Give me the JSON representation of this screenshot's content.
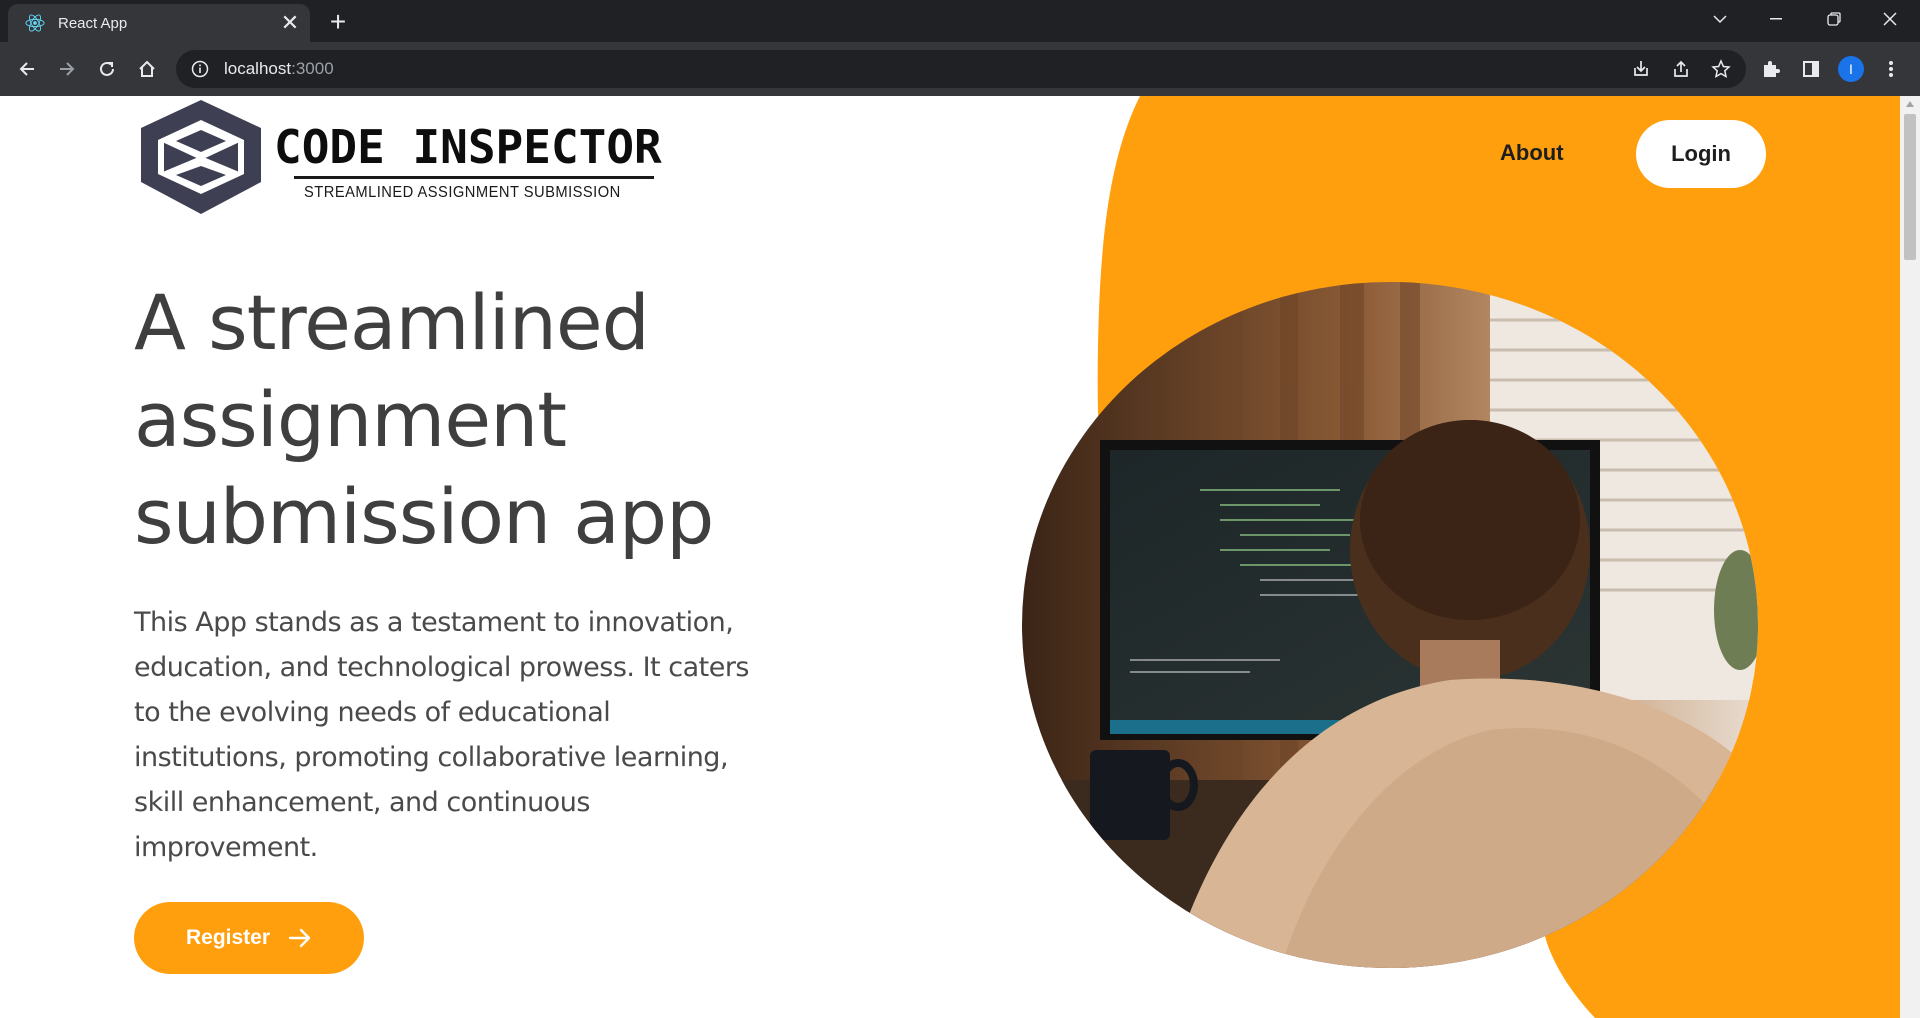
{
  "browser": {
    "tab_title": "React App",
    "url_host": "localhost",
    "url_port": ":3000",
    "profile_initial": "I"
  },
  "page": {
    "logo": {
      "title": "CODE INSPECTOR",
      "subtitle": "STREAMLINED ASSIGNMENT SUBMISSION"
    },
    "nav": {
      "about_label": "About",
      "login_label": "Login"
    },
    "hero": {
      "title": "A streamlined assignment submission app",
      "description": "This App stands as a testament to innovation, education, and technological prowess. It caters to the evolving needs of educational institutions, promoting collaborative learning, skill enhancement, and continuous improvement.",
      "register_label": "Register",
      "image_alt": "photo"
    }
  },
  "colors": {
    "accent": "#ff9f0d",
    "heading": "#3f3f3f",
    "logo_dark": "#3e3f52"
  },
  "icons": [
    "react-icon",
    "close-icon",
    "plus-icon",
    "back-icon",
    "forward-icon",
    "reload-icon",
    "home-icon",
    "info-icon",
    "install-icon",
    "share-icon",
    "star-icon",
    "extensions-icon",
    "side-panel-icon",
    "menu-icon",
    "arrow-right-icon"
  ]
}
